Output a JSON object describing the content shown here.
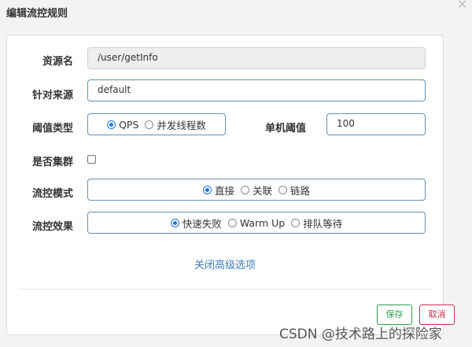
{
  "dialog": {
    "title": "编辑流控规则",
    "close_label": "×"
  },
  "fields": {
    "resource": {
      "label": "资源名",
      "value": "/user/getInfo"
    },
    "source": {
      "label": "针对来源",
      "value": "default"
    },
    "threshold_type": {
      "label": "阈值类型",
      "options": [
        "QPS",
        "并发线程数"
      ],
      "selected": "QPS"
    },
    "single_threshold": {
      "label": "单机阈值",
      "value": "100"
    },
    "cluster": {
      "label": "是否集群",
      "checked": false
    },
    "control_mode": {
      "label": "流控模式",
      "options": [
        "直接",
        "关联",
        "链路"
      ],
      "selected": "直接"
    },
    "control_effect": {
      "label": "流控效果",
      "options": [
        "快速失败",
        "Warm Up",
        "排队等待"
      ],
      "selected": "快速失败"
    }
  },
  "advanced_link": "关闭高级选项",
  "buttons": {
    "save": "保存",
    "cancel": "取消"
  },
  "watermark": "CSDN @技术路上的探险家",
  "colors": {
    "accent": "#1a73e8",
    "save": "#2e9f4f",
    "cancel": "#c6304f",
    "link": "#3d7cb8"
  }
}
